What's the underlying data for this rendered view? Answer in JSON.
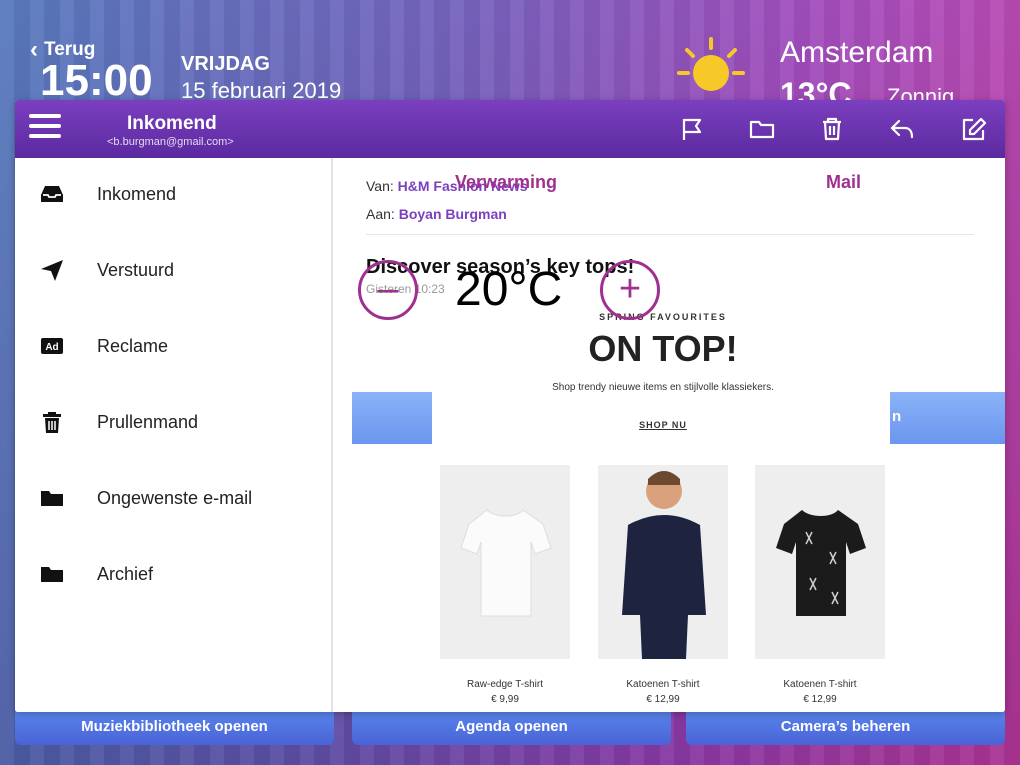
{
  "header": {
    "back_label": "Terug",
    "time": "15:00",
    "weekday": "VRIJDAG",
    "date": "15 februari 2019",
    "weather": {
      "city": "Amsterdam",
      "temperature": "13°C",
      "condition": "Zonnig",
      "icon": "sun-icon",
      "icon_color": "#f7c928"
    }
  },
  "underlay": {
    "heating_label": "Verwarming",
    "mail_label": "Mail",
    "heating_temp": "20°C",
    "minus_label": "–",
    "plus_label": "+",
    "partial_label": "n"
  },
  "bottom_buttons": [
    {
      "label": "Muziekbibliotheek openen"
    },
    {
      "label": "Agenda openen"
    },
    {
      "label": "Camera’s beheren"
    }
  ],
  "mail_app": {
    "title": "Inkomend",
    "account": "<b.burgman@gmail.com>",
    "toolbar_icons": [
      "flag-icon",
      "folder-icon",
      "trash-icon",
      "reply-icon",
      "compose-icon"
    ],
    "folders": [
      {
        "label": "Inkomend",
        "icon": "inbox-icon"
      },
      {
        "label": "Verstuurd",
        "icon": "send-icon"
      },
      {
        "label": "Reclame",
        "icon": "ad-icon"
      },
      {
        "label": "Prullenmand",
        "icon": "trash-icon"
      },
      {
        "label": "Ongewenste e-mail",
        "icon": "folder-icon"
      },
      {
        "label": "Archief",
        "icon": "folder-icon"
      }
    ],
    "message": {
      "from_label": "Van:",
      "from": "H&M Fashion News",
      "to_label": "Aan:",
      "to": "Boyan Burgman",
      "subject": "Discover season’s key tops!",
      "time": "Gisteren 10:23",
      "promo": {
        "kicker": "SPRING FAVOURITES",
        "headline": "ON TOP!",
        "tagline": "Shop trendy nieuwe items en stijlvolle klassiekers.",
        "cta": "SHOP NU"
      },
      "products": [
        {
          "name": "Raw-edge T-shirt",
          "price": "€ 9,99"
        },
        {
          "name": "Katoenen T-shirt",
          "price": "€ 12,99"
        },
        {
          "name": "Katoenen T-shirt",
          "price": "€ 12,99"
        }
      ]
    }
  },
  "colors": {
    "accent_purple": "#7b3fbf",
    "heating_accent": "#a0308f",
    "button_blue": "#5b8bf0"
  }
}
